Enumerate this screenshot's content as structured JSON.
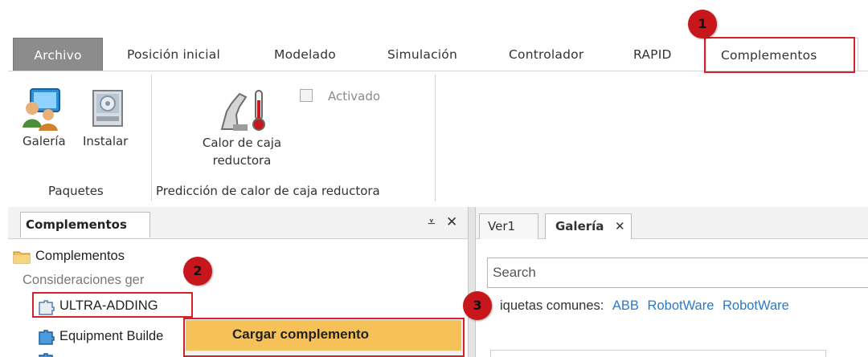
{
  "ribbon_tabs": [
    {
      "label": "Archivo"
    },
    {
      "label": "Posición inicial"
    },
    {
      "label": "Modelado"
    },
    {
      "label": "Simulación"
    },
    {
      "label": "Controlador"
    },
    {
      "label": "RAPID"
    },
    {
      "label": "Complementos"
    }
  ],
  "ribbon": {
    "galeria_label": "Galería",
    "instalar_label": "Instalar",
    "paquetes_group": "Paquetes",
    "calor_label_line1": "Calor de caja",
    "calor_label_line2": "reductora",
    "activado_label": "Activado",
    "prediccion_group": "Predicción de calor de caja reductora"
  },
  "left_panel": {
    "tab_label": "Complementos",
    "tree_root": "Complementos",
    "tree_section": "Consideraciones ger",
    "tree_items": [
      "ULTRA-ADDING",
      "Equipment Builde"
    ]
  },
  "context_menu": {
    "load_label": "Cargar complemento"
  },
  "right_panel": {
    "tabs": [
      "Ver1",
      "Galería"
    ],
    "search_placeholder": "Search",
    "tags_label": "iquetas comunes:",
    "tags": [
      "ABB",
      "RobotWare",
      "RobotWare"
    ]
  },
  "callouts": [
    "1",
    "2",
    "3"
  ],
  "colors": {
    "highlight": "#d2232a",
    "callout": "#c8161d",
    "menu_hover": "#f7c15a",
    "file_tab": "#8c8c8c",
    "link": "#2a7ac7"
  }
}
